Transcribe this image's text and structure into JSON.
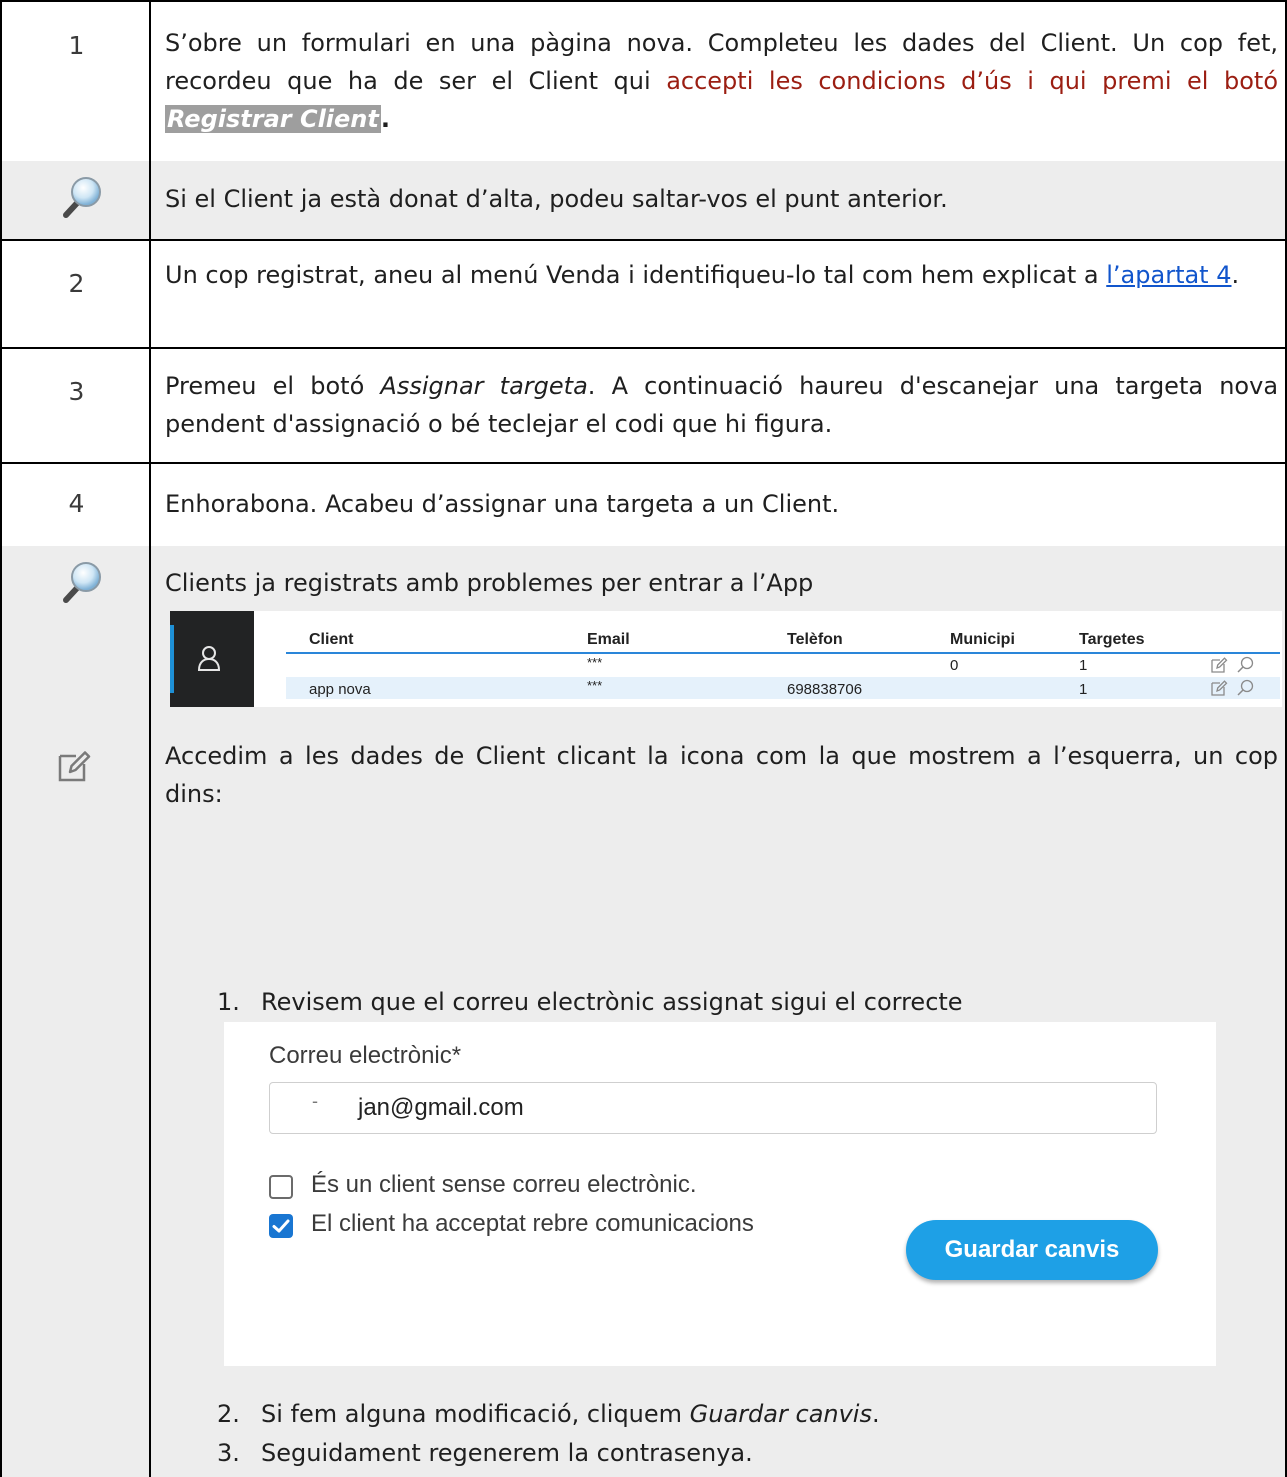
{
  "rows": {
    "r1": {
      "num": "1",
      "text_a": "S’obre un formulari en una pàgina nova. Completeu les dades del Client. Un cop fet, recordeu que ha de ser el Client qui ",
      "text_red": "accepti les condicions d’ús i qui premi el botó",
      "text_highlight": "Registrar Client",
      "text_end": "."
    },
    "tip1": {
      "icon": "magnifier-icon",
      "text": "Si el Client ja està donat d’alta, podeu saltar-vos el punt anterior."
    },
    "r2": {
      "num": "2",
      "text_a": "Un cop registrat, aneu al menú Venda i identifiqueu-lo tal com hem explicat a ",
      "link": "l’apartat 4",
      "text_end": "."
    },
    "r3": {
      "num": "3",
      "text_a": "Premeu el botó ",
      "em": "Assignar targeta",
      "text_b": ". A continuació haureu d'escanejar una targeta nova pendent d'assignació o bé teclejar el codi que hi figura."
    },
    "r4": {
      "num": "4",
      "text": "Enhorabona. Acabeu d’assignar una targeta a un Client."
    },
    "tip2": {
      "icon": "magnifier-icon",
      "text": "Clients ja registrats amb problemes per entrar a l’App"
    },
    "r6": {
      "icon": "edit-icon",
      "intro": "Accedim a les dades de Client clicant la icona com la que mostrem a l’esquerra, un cop dins:",
      "step1_num": "1.",
      "step1": "Revisem que el correu electrònic assignat sigui el correcte",
      "step2_num": "2.",
      "step2_a": "Si fem alguna modificació, cliquem ",
      "step2_em": "Guardar canvis",
      "step2_end": ".",
      "step3_num": "3.",
      "step3": "Seguidament regenerem la contrasenya."
    }
  },
  "client_table": {
    "side_icon": "user-icon",
    "headers": {
      "client": "Client",
      "email": "Email",
      "telefon": "Telèfon",
      "municipi": "Municipi",
      "targetes": "Targetes"
    },
    "rows": [
      {
        "client": "",
        "email": "***",
        "telefon": "",
        "municipi": "0",
        "targetes": "1"
      },
      {
        "client": "app nova",
        "email": "***",
        "telefon": "698838706",
        "municipi": "",
        "targetes": "1"
      }
    ],
    "accent": "#2a86d9",
    "highlight_row": "#e5f1fb"
  },
  "email_form": {
    "label": "Correu electrònic*",
    "value": "jan@gmail.com",
    "value_prefix": "-",
    "checkbox_no_email": {
      "label": "És un client sense correu electrònic.",
      "checked": false
    },
    "checkbox_comms": {
      "label": "El client ha acceptat rebre comunicacions",
      "checked": true
    },
    "save_button": "Guardar canvis",
    "button_color": "#1ea0e6"
  }
}
